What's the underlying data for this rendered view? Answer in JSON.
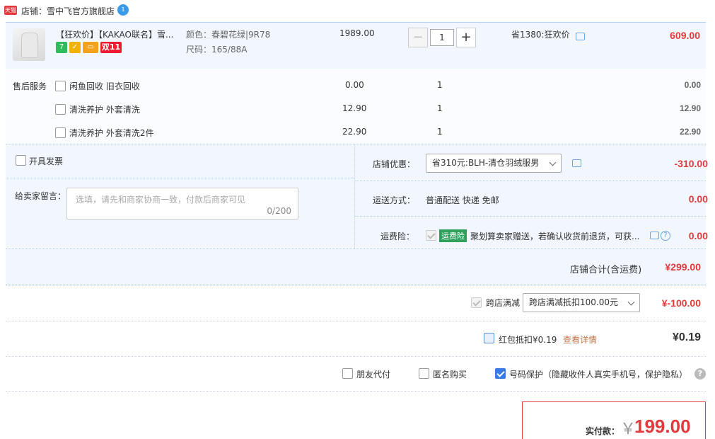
{
  "shop": {
    "badge": "天猫",
    "label": "店铺：雪中飞官方旗舰店",
    "ww_badge": "1"
  },
  "item": {
    "title": "【狂欢价】【KAKAO联名】雪...",
    "badges": [
      "7",
      "",
      "",
      "双11"
    ],
    "sku_color": "颜色：春碧花绿|9R78",
    "sku_size": "尺码：165/88A",
    "unit_price": "1989.00",
    "quantity": "1",
    "minus": "−",
    "plus": "+",
    "promo": "省1380:狂欢价",
    "total": "609.00"
  },
  "services": {
    "label": "售后服务",
    "rows": [
      {
        "name": "闲鱼回收 旧衣回收",
        "price": "0.00",
        "qty": "1",
        "total": "0.00"
      },
      {
        "name": "清洗养护 外套清洗",
        "price": "12.90",
        "qty": "1",
        "total": "12.90"
      },
      {
        "name": "清洗养护 外套清洗2件",
        "price": "22.90",
        "qty": "1",
        "total": "22.90"
      }
    ]
  },
  "options": {
    "invoice_label": "开具发票",
    "memo_label": "给卖家留言：",
    "memo_placeholder": "选填，请先和商家协商一致，付款后商家可见",
    "memo_count": "0/200",
    "shop_discount_label": "店铺优惠：",
    "shop_discount_value": "省310元:BLH-清仓羽绒服男",
    "shop_discount_amount": "-310.00",
    "shipping_label": "运送方式：",
    "shipping_value": "普通配送 快递 免邮",
    "shipping_amount": "0.00",
    "insurance_label": "运费险：",
    "insurance_tag": "运费险",
    "insurance_text": "聚划算卖家赠送，若确认收货前退货，可获...",
    "insurance_amount": "0.00",
    "shop_total_label": "店铺合计(含运费)",
    "shop_total": "¥299.00"
  },
  "cross_store": {
    "label": "跨店满减",
    "select": "跨店满减抵扣100.00元",
    "amount": "¥-100.00"
  },
  "red_packet": {
    "label": "红包抵扣¥0.19",
    "link": "查看详情",
    "amount": "¥0.19"
  },
  "extra": {
    "friend_pay": "朋友代付",
    "anonymous": "匿名购买",
    "number_protect": "号码保护（隐藏收件人真实手机号，保护隐私）",
    "help": "?"
  },
  "payment": {
    "label": "实付款：",
    "currency": "￥",
    "amount": "199.00"
  },
  "colors": {
    "accent_red": "#e4393c",
    "light_blue_bg": "#f2f7ff",
    "checkbox_blue": "#3a7ae6"
  }
}
